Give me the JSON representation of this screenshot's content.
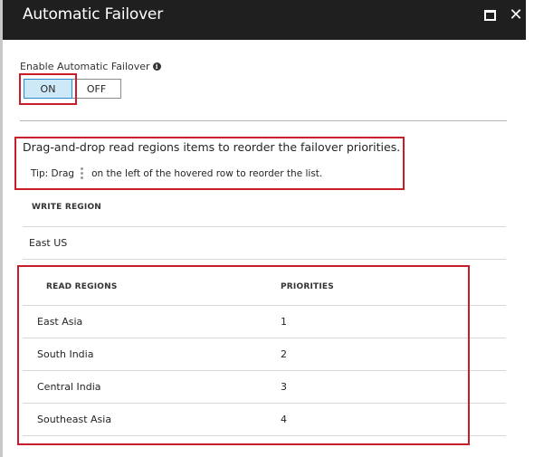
{
  "window": {
    "title": "Automatic Failover",
    "maximize_icon": "maximize-icon",
    "close_icon": "close-icon",
    "close_glyph": "✕"
  },
  "failover": {
    "enable_label": "Enable Automatic Failover",
    "info_icon": "info-icon",
    "info_glyph": "i",
    "on_label": "ON",
    "off_label": "OFF",
    "selected": "ON"
  },
  "instructions": {
    "main": "Drag-and-drop read regions items to reorder the failover priorities.",
    "tip_prefix": "Tip: Drag",
    "drag_icon": "drag-handle-icon",
    "tip_suffix": "on the left of the hovered row to reorder the list."
  },
  "write_region": {
    "header": "WRITE REGION",
    "value": "East US"
  },
  "read_regions": {
    "header": "READ REGIONS",
    "priority_header": "PRIORITIES",
    "rows": [
      {
        "region": "East Asia",
        "priority": "1"
      },
      {
        "region": "South India",
        "priority": "2"
      },
      {
        "region": "Central India",
        "priority": "3"
      },
      {
        "region": "Southeast Asia",
        "priority": "4"
      }
    ]
  },
  "colors": {
    "titlebar": "#1f1f1f",
    "highlight_box": "#c71e2a",
    "toggle_on_bg": "#cde8f7",
    "toggle_on_border": "#2c8bd1"
  }
}
